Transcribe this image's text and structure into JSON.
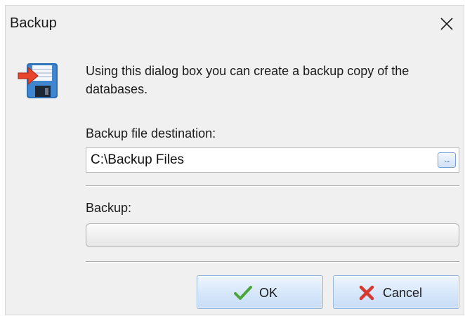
{
  "window": {
    "title": "Backup"
  },
  "dialog": {
    "description": "Using this dialog box you can create a backup copy of the databases.",
    "destination_label": "Backup file destination:",
    "destination_value": "C:\\Backup Files",
    "browse_label": "...",
    "progress_label": "Backup:",
    "progress_fraction": 0
  },
  "buttons": {
    "ok_label": "OK",
    "cancel_label": "Cancel"
  },
  "icons": {
    "app": "floppy-disk-with-arrow-icon",
    "close": "close-icon",
    "ok": "checkmark-icon",
    "cancel": "cross-icon"
  },
  "colors": {
    "window_bg": "#f0f0f0",
    "button_border": "#8fb2dd",
    "ok_check": "#4aa53a",
    "cancel_cross": "#d6392e",
    "floppy_blue": "#2c6fb6",
    "arrow_red": "#e8452c"
  }
}
